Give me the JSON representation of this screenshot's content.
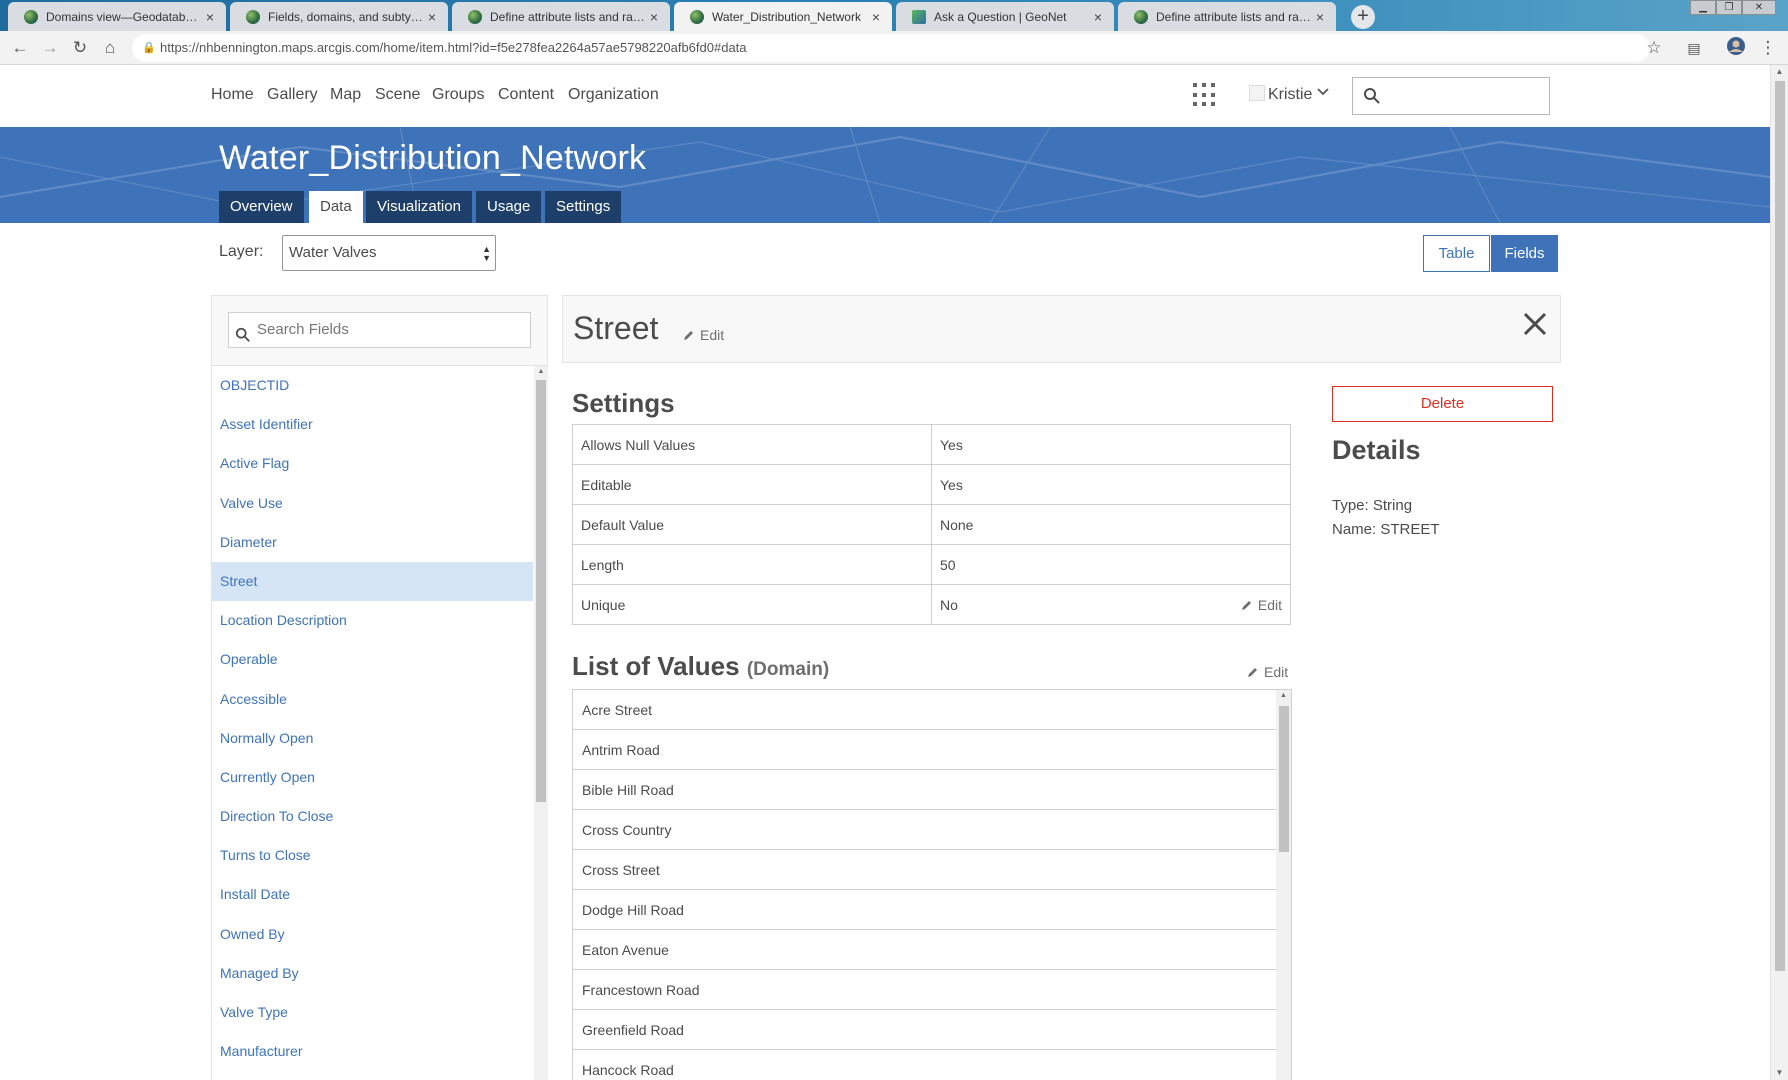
{
  "browser": {
    "tabs": [
      {
        "label": "Domains view—Geodatabases | A",
        "active": false,
        "icon": "globe-icon"
      },
      {
        "label": "Fields, domains, and subtypes—",
        "active": false,
        "icon": "globe-icon"
      },
      {
        "label": "Define attribute lists and ranges",
        "active": false,
        "icon": "globe-icon"
      },
      {
        "label": "Water_Distribution_Network",
        "active": true,
        "icon": "globe-icon"
      },
      {
        "label": "Ask a Question | GeoNet",
        "active": false,
        "icon": "geonet-icon"
      },
      {
        "label": "Define attribute lists and ranges",
        "active": false,
        "icon": "globe-icon"
      }
    ],
    "url": "https://nhbennington.maps.arcgis.com/home/item.html?id=f5e278fea2264a57ae5798220afb6fd0#data"
  },
  "nav": {
    "links": [
      "Home",
      "Gallery",
      "Map",
      "Scene",
      "Groups",
      "Content",
      "Organization"
    ],
    "user": "Kristie"
  },
  "item": {
    "title": "Water_Distribution_Network",
    "tabs": [
      "Overview",
      "Data",
      "Visualization",
      "Usage",
      "Settings"
    ],
    "active_tab": "Data"
  },
  "layer": {
    "label": "Layer:",
    "selected": "Water Valves"
  },
  "view_toggle": {
    "table": "Table",
    "fields": "Fields",
    "active": "Fields"
  },
  "fields_panel": {
    "search_placeholder": "Search Fields",
    "items": [
      "OBJECTID",
      "Asset Identifier",
      "Active Flag",
      "Valve Use",
      "Diameter",
      "Street",
      "Location Description",
      "Operable",
      "Accessible",
      "Normally Open",
      "Currently Open",
      "Direction To Close",
      "Turns to Close",
      "Install Date",
      "Owned By",
      "Managed By",
      "Valve Type",
      "Manufacturer"
    ],
    "selected": "Street"
  },
  "field_detail": {
    "name": "Street",
    "edit_label": "Edit",
    "settings_title": "Settings",
    "settings": [
      {
        "key": "Allows Null Values",
        "value": "Yes"
      },
      {
        "key": "Editable",
        "value": "Yes"
      },
      {
        "key": "Default Value",
        "value": "None"
      },
      {
        "key": "Length",
        "value": "50"
      },
      {
        "key": "Unique",
        "value": "No"
      }
    ],
    "unique_edit_label": "Edit",
    "domain_title": "List of Values",
    "domain_suffix": "(Domain)",
    "domain_edit_label": "Edit",
    "domain_values": [
      "Acre Street",
      "Antrim Road",
      "Bible Hill Road",
      "Cross Country",
      "Cross Street",
      "Dodge Hill Road",
      "Eaton Avenue",
      "Francestown Road",
      "Greenfield Road",
      "Hancock Road"
    ],
    "delete_label": "Delete",
    "details_title": "Details",
    "type_line": "Type: String",
    "name_line": "Name: STREET"
  },
  "colors": {
    "brand_blue": "#3f73b9",
    "tab_dark": "#1d3f69",
    "link_blue": "#3f73b9",
    "danger": "#d83020",
    "selected_row": "#d6e5f5"
  }
}
